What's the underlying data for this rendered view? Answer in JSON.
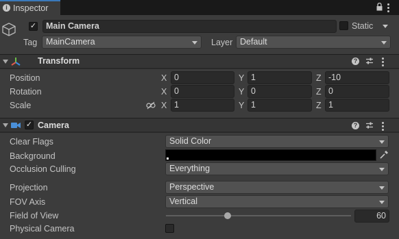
{
  "tab": {
    "title": "Inspector",
    "icon": "info-icon"
  },
  "header": {
    "active": true,
    "name": "Main Camera",
    "static_label": "Static",
    "tag_label": "Tag",
    "tag_value": "MainCamera",
    "layer_label": "Layer",
    "layer_value": "Default"
  },
  "transform": {
    "title": "Transform",
    "rows": [
      {
        "label": "Position",
        "x": "0",
        "y": "1",
        "z": "-10"
      },
      {
        "label": "Rotation",
        "x": "0",
        "y": "0",
        "z": "0"
      },
      {
        "label": "Scale",
        "x": "1",
        "y": "1",
        "z": "1"
      }
    ],
    "axis_x": "X",
    "axis_y": "Y",
    "axis_z": "Z"
  },
  "camera": {
    "title": "Camera",
    "enabled": true,
    "clear_flags_label": "Clear Flags",
    "clear_flags_value": "Solid Color",
    "background_label": "Background",
    "background_color": "#000000",
    "occlusion_label": "Occlusion Culling",
    "occlusion_value": "Everything",
    "projection_label": "Projection",
    "projection_value": "Perspective",
    "fov_axis_label": "FOV Axis",
    "fov_axis_value": "Vertical",
    "fov_label": "Field of View",
    "fov_value": "60",
    "fov_slider_fraction": 0.333,
    "physical_label": "Physical Camera",
    "physical_checked": false
  },
  "colors": {
    "accent": "#3a79bb",
    "panel": "#3c3c3c",
    "component_bar": "#353535"
  }
}
